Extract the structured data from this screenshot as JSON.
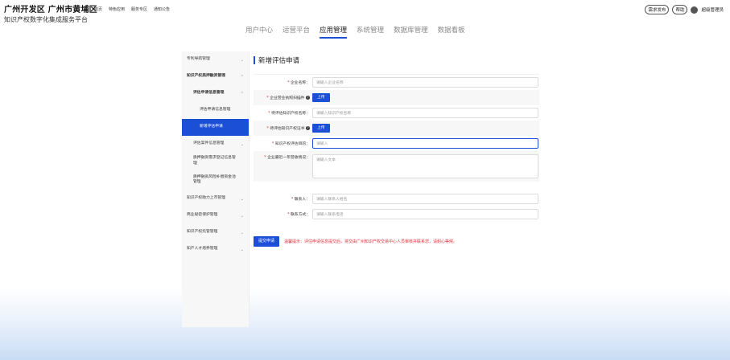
{
  "brand": {
    "title": "广州开发区 广州市黄埔区",
    "subtitle": "知识产权数字化集成服务平台"
  },
  "topnav": [
    "首页",
    "特色应用",
    "服务专区",
    "通知公告"
  ],
  "tools": {
    "demand": "需求发布",
    "help": "帮助",
    "user": "超级管理员"
  },
  "main_tabs": [
    {
      "label": "用户中心",
      "active": false
    },
    {
      "label": "运营平台",
      "active": false
    },
    {
      "label": "应用管理",
      "active": true
    },
    {
      "label": "系统管理",
      "active": false
    },
    {
      "label": "数据库管理",
      "active": false
    },
    {
      "label": "数据看板",
      "active": false
    }
  ],
  "sidebar": {
    "items": [
      {
        "label": "专利导航管理"
      },
      {
        "label": "知识产权质押融资管理"
      },
      {
        "label": "评估申请信息管理"
      },
      {
        "label": "评估申请信息管理"
      },
      {
        "label": "新增评估申请"
      },
      {
        "label": "评估案件信息管理"
      },
      {
        "label": "质押融资需求登记信息管理"
      },
      {
        "label": "质押融资风险补偿资金池管理"
      },
      {
        "label": "知识产权助力上市管理"
      },
      {
        "label": "商业秘密保护管理"
      },
      {
        "label": "知识产权托管管理"
      },
      {
        "label": "知产人才培养管理"
      }
    ]
  },
  "page": {
    "title": "新增评估申请"
  },
  "form": {
    "company_name": {
      "label": "企业名称：",
      "placeholder": "请输入企业名称"
    },
    "license": {
      "label": "企业营业执照扫描件",
      "button": "上传"
    },
    "ip_name": {
      "label": "待评估知识产权名称：",
      "placeholder": "请输入知识产权名称"
    },
    "ip_cert": {
      "label": "待评估知识产权证书",
      "button": "上传"
    },
    "purpose": {
      "label": "知识产权评估目的：",
      "placeholder": "请输入"
    },
    "operation": {
      "label": "企业最近一年营收情况：",
      "placeholder": "请输入文本"
    },
    "contact": {
      "label": "联系人：",
      "placeholder": "请输入联系人姓名"
    },
    "phone": {
      "label": "联系方式：",
      "placeholder": "请输入联系电话"
    }
  },
  "submit": {
    "label": "提交申请",
    "tip": "温馨提示：评估申请信息提交后，将交由广州知识产权交易中心人员审核并联系您，请耐心等候。"
  },
  "colors": {
    "accent": "#1a4fd6",
    "required": "#e0303a"
  }
}
